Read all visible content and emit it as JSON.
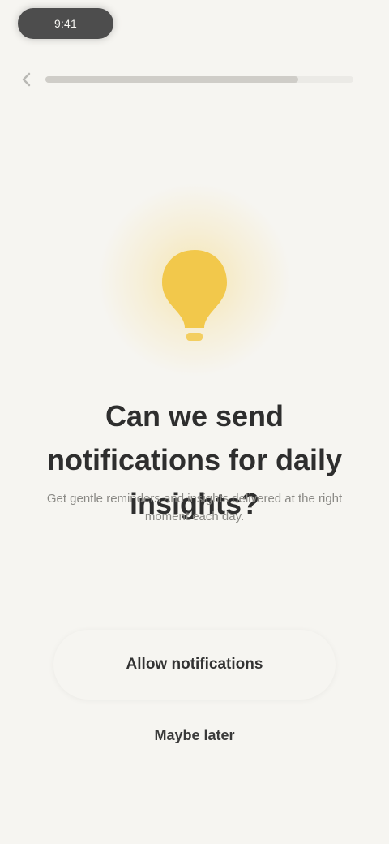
{
  "status": {
    "time": "9:41"
  },
  "header": {
    "back_icon": "chevron-left-icon",
    "progress_fraction": 0.82
  },
  "hero": {
    "icon": "lightbulb-icon",
    "accent_color": "#f2c84b"
  },
  "content": {
    "title": "Can we send notifications for daily insights?",
    "subtitle": "Get gentle reminders and insights delivered at the right moment each day."
  },
  "actions": {
    "primary_label": "Allow notifications",
    "secondary_label": "Maybe later"
  }
}
